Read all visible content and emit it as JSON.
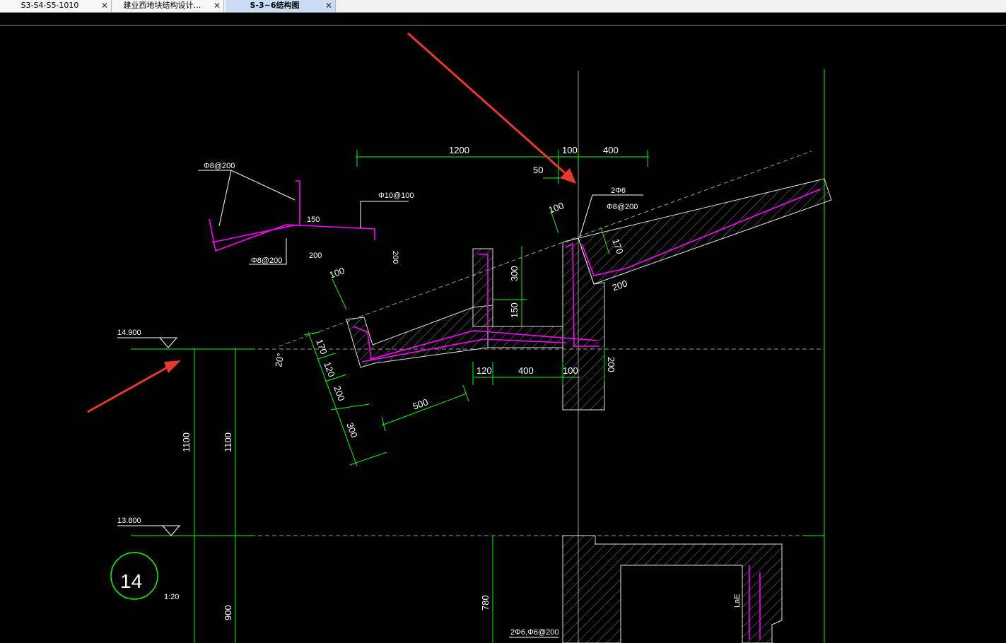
{
  "tabs": [
    {
      "label": "S3-S4-S5-1010",
      "close": "✕"
    },
    {
      "label": "建业西地块结构设计…",
      "close": "✕"
    },
    {
      "label": "S-3~6结构图",
      "close": "✕"
    }
  ],
  "drawing": {
    "dims_top": [
      "1200",
      "100",
      "400",
      "50"
    ],
    "rebar": [
      "Φ8@200",
      "Φ10@100",
      "150",
      "200",
      "200",
      "Φ8@200",
      "2Φ6",
      "Φ8@200"
    ],
    "dims_mid": [
      "100",
      "100",
      "170",
      "200",
      "300",
      "150"
    ],
    "dims_left": [
      "100",
      "170",
      "120",
      "200",
      "300",
      "500",
      "20°"
    ],
    "dims_bottom": [
      "120",
      "400",
      "100",
      "200"
    ],
    "levels": [
      "14.900",
      "13.800"
    ],
    "vertical_dims": [
      "1100",
      "1100",
      "900",
      "780"
    ],
    "lower": [
      "2Φ6,Φ6@200",
      "LaE"
    ],
    "detail_number": "14",
    "scale": "1:20"
  },
  "colors": {
    "green": "#00ff00",
    "magenta": "#ff00ff",
    "white": "#ffffff",
    "gray": "#9a9a9a",
    "red": "#e8392c",
    "cyan": "#00cccc"
  }
}
